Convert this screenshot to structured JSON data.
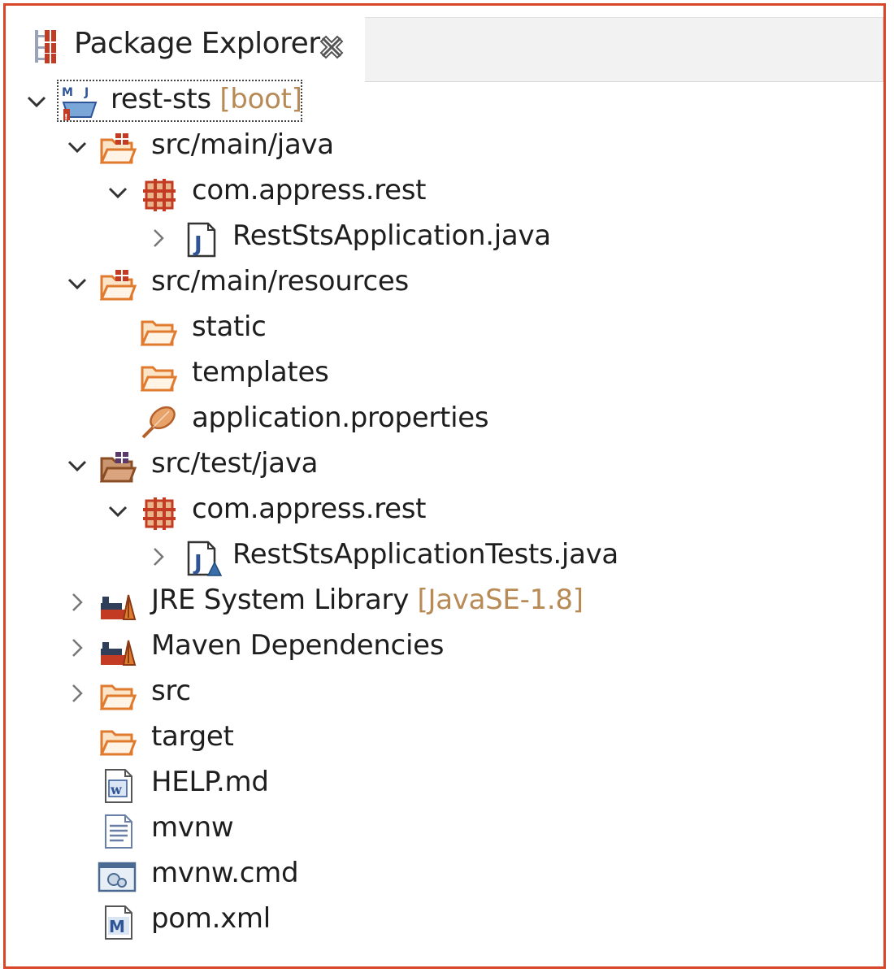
{
  "view": {
    "tab_title": "Package Explorer",
    "tab_icon": "package-explorer-icon",
    "close_icon": "close-icon"
  },
  "colors": {
    "frame_border": "#d9472b",
    "decoration_text": "#b88a55",
    "folder_orange": "#e07a2e",
    "package_red": "#c23b22",
    "java_blue": "#2f5597"
  },
  "tree": {
    "project": {
      "name": "rest-sts",
      "decoration": "[boot]"
    },
    "src_main_java": {
      "label": "src/main/java"
    },
    "pkg_main": {
      "label": "com.appress.rest"
    },
    "app_java": {
      "label": "RestStsApplication.java"
    },
    "src_main_resources": {
      "label": "src/main/resources"
    },
    "static": {
      "label": "static"
    },
    "templates": {
      "label": "templates"
    },
    "app_props": {
      "label": "application.properties"
    },
    "src_test_java": {
      "label": "src/test/java"
    },
    "pkg_test": {
      "label": "com.appress.rest"
    },
    "tests_java": {
      "label": "RestStsApplicationTests.java"
    },
    "jre": {
      "name": "JRE System Library",
      "decoration": "[JavaSE-1.8]"
    },
    "maven_deps": {
      "label": "Maven Dependencies"
    },
    "src": {
      "label": "src"
    },
    "target": {
      "label": "target"
    },
    "help_md": {
      "label": "HELP.md"
    },
    "mvnw": {
      "label": "mvnw"
    },
    "mvnw_cmd": {
      "label": "mvnw.cmd"
    },
    "pom_xml": {
      "label": "pom.xml"
    }
  }
}
